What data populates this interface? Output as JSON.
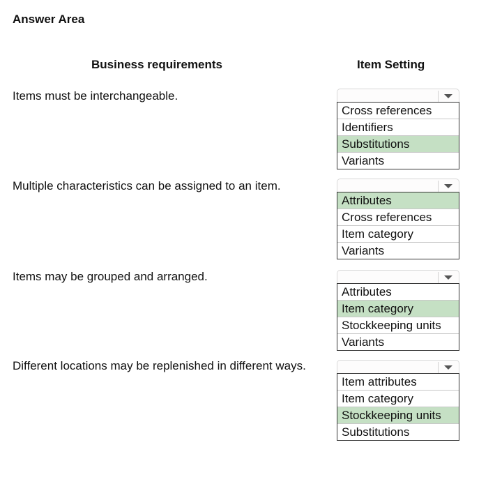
{
  "title": "Answer Area",
  "headers": {
    "requirements": "Business requirements",
    "setting": "Item Setting"
  },
  "highlight_color": "#c5e0c4",
  "rows": [
    {
      "requirement": "Items must be interchangeable.",
      "options": [
        "Cross references",
        "Identifiers",
        "Substitutions",
        "Variants"
      ],
      "selected": "Substitutions"
    },
    {
      "requirement": "Multiple characteristics can be assigned to an item.",
      "options": [
        "Attributes",
        "Cross references",
        "Item category",
        "Variants"
      ],
      "selected": "Attributes"
    },
    {
      "requirement": "Items may be grouped and arranged.",
      "options": [
        "Attributes",
        "Item category",
        "Stockkeeping units",
        "Variants"
      ],
      "selected": "Item category"
    },
    {
      "requirement": "Different locations may be replenished in different ways.",
      "options": [
        "Item attributes",
        "Item category",
        "Stockkeeping units",
        "Substitutions"
      ],
      "selected": "Stockkeeping units"
    }
  ]
}
